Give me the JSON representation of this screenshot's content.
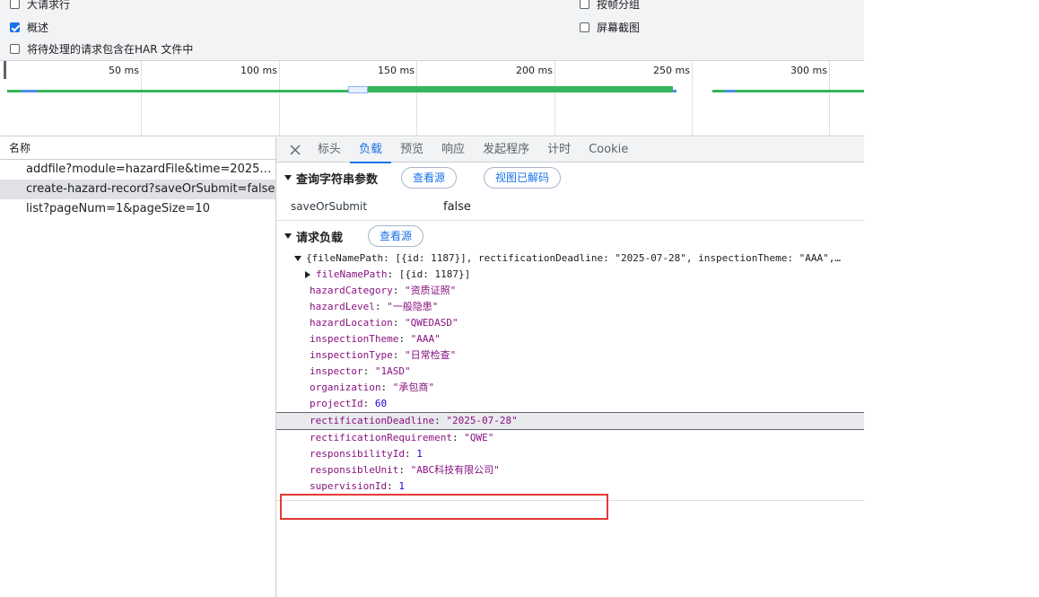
{
  "options": {
    "large_rows": "大请求行",
    "overview": "概述",
    "include_pending_har": "将待处理的请求包含在HAR 文件中",
    "group_by_frame": "按帧分组",
    "screenshots": "屏幕截图"
  },
  "timeline": {
    "ticks": [
      "50 ms",
      "100 ms",
      "150 ms",
      "200 ms",
      "250 ms",
      "300 ms"
    ],
    "colors": {
      "green": "#36b55c",
      "blue": "#4e8ee6"
    }
  },
  "request_list": {
    "header": "名称",
    "rows": [
      "addfile?module=hazardFile&time=2025-07...",
      "create-hazard-record?saveOrSubmit=false",
      "list?pageNum=1&pageSize=10"
    ]
  },
  "tabs": [
    "标头",
    "负载",
    "预览",
    "响应",
    "发起程序",
    "计时",
    "Cookie"
  ],
  "query": {
    "title": "查询字符串参数",
    "view_source": "查看源",
    "view_decoded": "视图已解码",
    "params": [
      {
        "key": "saveOrSubmit",
        "value": "false"
      }
    ]
  },
  "payload": {
    "title": "请求负载",
    "view_source": "查看源",
    "root_summary": "{fileNamePath: [{id: 1187}], rectificationDeadline: \"2025-07-28\", inspectionTheme: \"AAA\",…",
    "file_name_path": {
      "key": "fileNamePath",
      "value": "[{id: 1187}]"
    },
    "fields": [
      {
        "key": "hazardCategory",
        "value": "\"资质证照\"",
        "kind": "s"
      },
      {
        "key": "hazardLevel",
        "value": "\"一般隐患\"",
        "kind": "s"
      },
      {
        "key": "hazardLocation",
        "value": "\"QWEDASD\"",
        "kind": "s"
      },
      {
        "key": "inspectionTheme",
        "value": "\"AAA\"",
        "kind": "s"
      },
      {
        "key": "inspectionType",
        "value": "\"日常检查\"",
        "kind": "s"
      },
      {
        "key": "inspector",
        "value": "\"1ASD\"",
        "kind": "s"
      },
      {
        "key": "organization",
        "value": "\"承包商\"",
        "kind": "s"
      },
      {
        "key": "projectId",
        "value": "60",
        "kind": "n"
      },
      {
        "key": "rectificationDeadline",
        "value": "\"2025-07-28\"",
        "kind": "s"
      },
      {
        "key": "rectificationRequirement",
        "value": "\"QWE\"",
        "kind": "s"
      },
      {
        "key": "responsibilityId",
        "value": "1",
        "kind": "n"
      },
      {
        "key": "responsibleUnit",
        "value": "\"ABC科技有限公司\"",
        "kind": "s"
      },
      {
        "key": "supervisionId",
        "value": "1",
        "kind": "n"
      }
    ]
  }
}
